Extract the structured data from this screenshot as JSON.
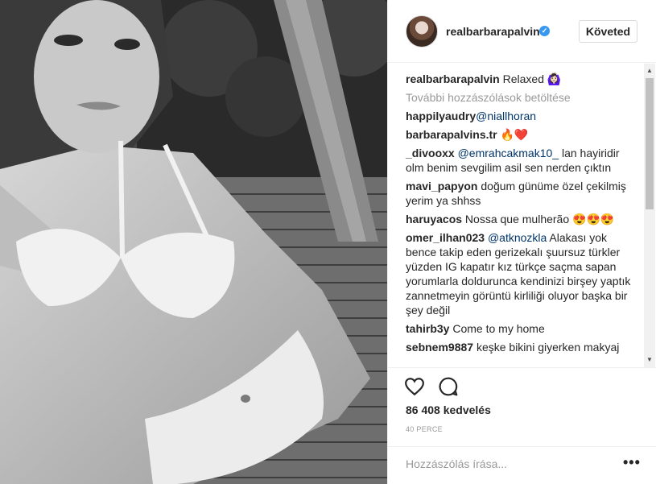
{
  "post": {
    "username": "realbarbarapalvin",
    "verified_mark": "✓",
    "follow_label": "Követed",
    "caption": {
      "user": "realbarbarapalvin",
      "text": " Relaxed 🙆🏻‍♀️"
    },
    "load_more": "További hozzászólások betöltése",
    "comments": [
      {
        "user": "happilyaudry",
        "text": "",
        "mention": "@niallhoran",
        "text_after": ""
      },
      {
        "user": "barbarapalvins.tr",
        "text": " 🔥❤️",
        "mention": "",
        "text_after": ""
      },
      {
        "user": "_divooxx",
        "text": " ",
        "mention": "@emrahcakmak10_",
        "text_after": " lan hayiridir olm benim sevgilim asil sen nerden çıktın"
      },
      {
        "user": "mavi_papyon",
        "text": " doğum günüme özel çekilmiş yerim ya shhss",
        "mention": "",
        "text_after": ""
      },
      {
        "user": "haruyacos",
        "text": " Nossa que mulherão 😍😍😍",
        "mention": "",
        "text_after": ""
      },
      {
        "user": "omer_ilhan023",
        "text": " ",
        "mention": "@atknozkla",
        "text_after": " Alakası yok bence takip eden gerizekalı şuursuz türkler yüzden IG kapatır kız türkçe saçma sapan yorumlarla doldurunca kendinizi birşey yaptık zannetmeyin görüntü kirliliği oluyor başka bir şey değil"
      },
      {
        "user": "tahirb3y",
        "text": " Come to my home",
        "mention": "",
        "text_after": ""
      },
      {
        "user": "sebnem9887",
        "text": " keşke bikini giyerken makyaj",
        "mention": "",
        "text_after": ""
      }
    ],
    "likes": "86 408 kedvelés",
    "time": "40 PERCE",
    "comment_placeholder": "Hozzászólás írása...",
    "more_label": "•••"
  },
  "icons": {
    "heart": "heart-icon",
    "comment": "comment-icon",
    "scroll_up": "▲",
    "scroll_down": "▼"
  },
  "colors": {
    "mention": "#003569",
    "verified": "#3897f0",
    "muted": "#999999"
  }
}
